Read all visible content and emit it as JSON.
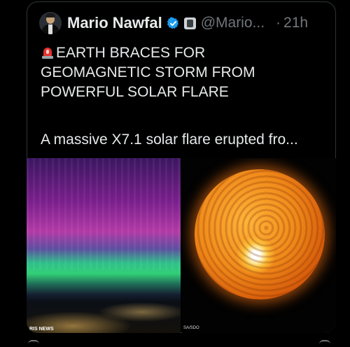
{
  "post": {
    "author_name": "Mario Nawfal",
    "handle": "@Mario...",
    "separator": "·",
    "time": "21h",
    "title_lines": [
      "EARTH BRACES FOR",
      "GEOMAGNETIC STORM FROM",
      "POWERFUL SOLAR FLARE"
    ],
    "snippet": "A massive X7.1 solar flare erupted fro..."
  },
  "media": {
    "left_credit": "RIS NEWS",
    "right_credit": "SA/SDO"
  },
  "icons": {
    "verified": "verified-badge-icon",
    "affiliate": "affiliate-badge-icon",
    "alert": "police-light-emoji-icon"
  },
  "colors": {
    "background": "#000000",
    "text": "#e7e9ea",
    "muted": "#71767b",
    "verified_blue": "#1d9bf0",
    "border": "#2f3336"
  }
}
